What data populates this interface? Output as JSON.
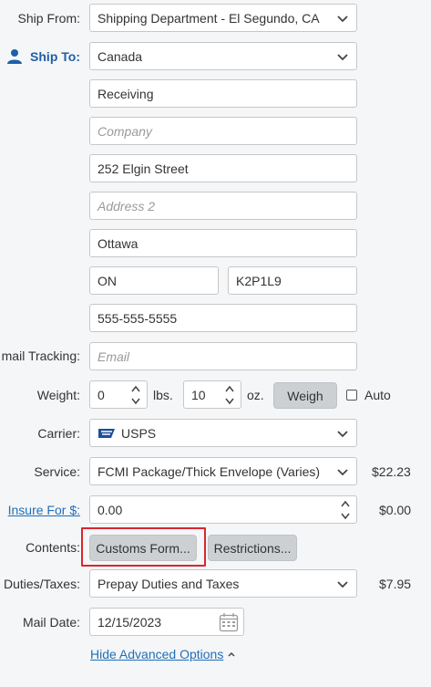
{
  "form": {
    "ship_from": {
      "label": "Ship From:",
      "value": "Shipping Department - El Segundo, CA",
      "icon": "chevron-down-icon"
    },
    "ship_to": {
      "label": "Ship To:",
      "icon": "person-icon",
      "country": "Canada",
      "name": "Receiving",
      "company_placeholder": "Company",
      "address1": "252 Elgin Street",
      "address2_placeholder": "Address 2",
      "city": "Ottawa",
      "province": "ON",
      "postal": "K2P1L9",
      "phone": "555-555-5555"
    },
    "email_tracking": {
      "label": "mail Tracking:",
      "placeholder": "Email"
    },
    "weight": {
      "label": "Weight:",
      "lbs": "0",
      "lbs_unit": "lbs.",
      "oz": "10",
      "oz_unit": "oz.",
      "weigh_button": "Weigh",
      "auto_label": "Auto"
    },
    "carrier": {
      "label": "Carrier:",
      "value": "USPS",
      "icon": "usps-logo-icon"
    },
    "service": {
      "label": "Service:",
      "value": "FCMI Package/Thick Envelope (Varies)",
      "price": "$22.23"
    },
    "insure": {
      "label": "Insure For $:",
      "value": "0.00",
      "price": "$0.00"
    },
    "contents": {
      "label": "Contents:",
      "customs_button": "Customs Form...",
      "restrictions_button": "Restrictions..."
    },
    "duties": {
      "label": "Duties/Taxes:",
      "value": "Prepay Duties and Taxes",
      "price": "$7.95"
    },
    "mail_date": {
      "label": "Mail Date:",
      "value": "12/15/2023",
      "icon": "calendar-icon"
    },
    "hide_advanced": "Hide Advanced Options"
  },
  "colors": {
    "link": "#1f6fba",
    "highlight": "#d9262f",
    "button": "#cdd0d3"
  }
}
